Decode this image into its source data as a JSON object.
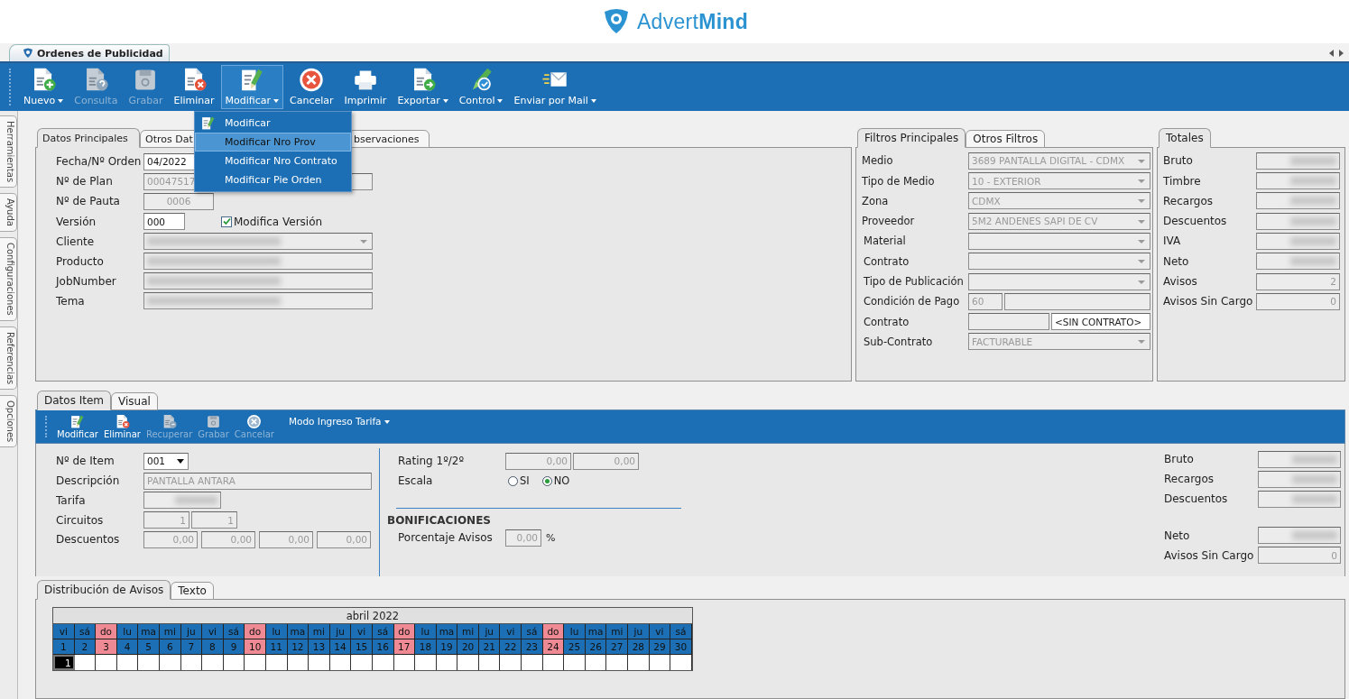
{
  "app": {
    "logo": "Advert**Mind**"
  },
  "document_tab": {
    "title": "Ordenes de Publicidad"
  },
  "toolbar": [
    {
      "label": "Nuevo",
      "kind": "new",
      "disabled": false,
      "dropdown": true,
      "selected": false
    },
    {
      "label": "Consulta",
      "kind": "query",
      "disabled": true,
      "dropdown": false,
      "selected": false
    },
    {
      "label": "Grabar",
      "kind": "save",
      "disabled": true,
      "dropdown": false,
      "selected": false
    },
    {
      "label": "Eliminar",
      "kind": "delete",
      "disabled": false,
      "dropdown": false,
      "selected": false
    },
    {
      "label": "Modificar",
      "kind": "edit",
      "disabled": false,
      "dropdown": true,
      "selected": true
    },
    {
      "label": "Cancelar",
      "kind": "cancel",
      "disabled": false,
      "dropdown": false,
      "selected": false
    },
    {
      "label": "Imprimir",
      "kind": "print",
      "disabled": false,
      "dropdown": false,
      "selected": false
    },
    {
      "label": "Exportar",
      "kind": "export",
      "disabled": false,
      "dropdown": true,
      "selected": false
    },
    {
      "label": "Control",
      "kind": "control",
      "disabled": false,
      "dropdown": true,
      "selected": false
    },
    {
      "label": "Enviar por Mail",
      "kind": "mail",
      "disabled": false,
      "dropdown": true,
      "selected": false
    }
  ],
  "menu": [
    {
      "label": "Modificar",
      "kind": "edit",
      "selected": false
    },
    {
      "label": "Modificar Nro Prov",
      "kind": "plain",
      "selected": true
    },
    {
      "label": "Modificar Nro Contrato",
      "kind": "plain",
      "selected": false
    },
    {
      "label": "Modificar Pie Orden",
      "kind": "plain",
      "selected": false
    }
  ],
  "side_tabs": [
    "Herramientas",
    "Ayuda",
    "Configuraciones",
    "Referencias",
    "Opciones"
  ],
  "main_tabs": [
    {
      "label": "Datos Principales",
      "selected": true
    },
    {
      "label": "Otros Dat",
      "selected": false
    },
    {
      "label": "bservaciones",
      "selected": false
    }
  ],
  "datos_principales": {
    "fecha_orden": {
      "label": "Fecha/Nº Orden",
      "value": "04/2022",
      "editable": true
    },
    "plan": {
      "label": "Nº de Plan",
      "value": "00047517",
      "editable": false
    },
    "pauta": {
      "label": "Nº de Pauta",
      "value": "0006",
      "editable": false
    },
    "version": {
      "label": "Versión",
      "value": "000",
      "editable": true
    },
    "modifica_version": {
      "label": "Modifica Versión",
      "checked": true
    },
    "cliente": {
      "label": "Cliente",
      "redacted": true
    },
    "producto": {
      "label": "Producto",
      "redacted": true
    },
    "jobnumber": {
      "label": "JobNumber",
      "redacted": true
    },
    "tema": {
      "label": "Tema",
      "redacted": true
    }
  },
  "filtros": {
    "tabs": [
      {
        "label": "Filtros Principales",
        "selected": true
      },
      {
        "label": "Otros Filtros",
        "selected": false
      }
    ],
    "rows": [
      {
        "label": "Medio",
        "kind": "select",
        "value": "3689 PANTALLA DIGITAL - CDMX"
      },
      {
        "label": "Tipo de Medio",
        "kind": "select",
        "value": "10 - EXTERIOR"
      },
      {
        "label": "Zona",
        "kind": "select",
        "value": "CDMX"
      },
      {
        "label": "Proveedor",
        "kind": "select",
        "value": "5M2 ANDENES SAPI DE CV"
      },
      {
        "label": "Material",
        "kind": "select"
      },
      {
        "label": "Contrato",
        "kind": "select"
      },
      {
        "label": "Tipo de Publicación",
        "kind": "select"
      },
      {
        "label": "Condición de Pago",
        "kind": "pair",
        "value": "60"
      },
      {
        "label": "Contrato",
        "kind": "pair-wide",
        "value_2": "<SIN CONTRATO>"
      },
      {
        "label": "Sub-Contrato",
        "kind": "select",
        "value": "FACTURABLE"
      }
    ]
  },
  "totales": {
    "tab": "Totales",
    "rows": [
      {
        "label": "Bruto",
        "redacted": true
      },
      {
        "label": "Timbre",
        "redacted": true
      },
      {
        "label": "Recargos",
        "redacted": true
      },
      {
        "label": "Descuentos",
        "redacted": true
      },
      {
        "label": "IVA",
        "redacted": true
      },
      {
        "label": "Neto",
        "redacted": true
      },
      {
        "label": "Avisos",
        "value": "2"
      },
      {
        "label": "Avisos Sin Cargo",
        "value": "0"
      }
    ]
  },
  "item_tabs": [
    {
      "label": "Datos Item",
      "selected": true
    },
    {
      "label": "Visual",
      "selected": false
    }
  ],
  "item_toolbar": {
    "buttons": [
      {
        "label": "Modificar",
        "kind": "edit",
        "disabled": false
      },
      {
        "label": "Eliminar",
        "kind": "delete",
        "disabled": false
      },
      {
        "label": "Recuperar",
        "kind": "recover",
        "disabled": true
      },
      {
        "label": "Grabar",
        "kind": "save",
        "disabled": true
      },
      {
        "label": "Cancelar",
        "kind": "cancel",
        "disabled": true
      }
    ],
    "mode_menu": "Modo Ingreso Tarifa"
  },
  "item_form": {
    "item_no": {
      "label": "Nº de Item",
      "value": "001"
    },
    "descripcion": {
      "label": "Descripción",
      "value": "PANTALLA ANTARA"
    },
    "tarifa": {
      "label": "Tarifa",
      "redacted": true
    },
    "circuitos": {
      "label": "Circuitos",
      "values": [
        "1",
        "1"
      ]
    },
    "descuentos": {
      "label": "Descuentos",
      "values": [
        "0,00",
        "0,00",
        "0,00",
        "0,00"
      ]
    },
    "rating": {
      "label": "Rating 1º/2º",
      "values": [
        "0,00",
        "0,00"
      ]
    },
    "escala": {
      "label": "Escala",
      "options": [
        {
          "label": "SI",
          "selected": false
        },
        {
          "label": "NO",
          "selected": true
        }
      ]
    },
    "bonificaciones": {
      "title": "BONIFICACIONES",
      "label": "Porcentaje Avisos",
      "value": "0,00",
      "unit": "%"
    }
  },
  "item_totals": {
    "groups": [
      {
        "rows": [
          {
            "label": "Bruto",
            "redacted": true
          },
          {
            "label": "Recargos",
            "redacted": true
          },
          {
            "label": "Descuentos",
            "redacted": true
          }
        ]
      },
      {
        "rows": [
          {
            "label": "Neto",
            "redacted": true
          },
          {
            "label": "Avisos Sin Cargo",
            "value": "0"
          }
        ]
      }
    ]
  },
  "distribution": {
    "tabs": [
      {
        "label": "Distribución de Avisos",
        "selected": true
      },
      {
        "label": "Texto",
        "selected": false
      }
    ],
    "calendar": {
      "month": "abril 2022",
      "days": [
        {
          "weekday": "vi",
          "day": "1",
          "color": "#1c6fb4",
          "count": "1",
          "selected": true
        },
        {
          "weekday": "sá",
          "day": "2",
          "color": "#1c6fb4",
          "selected": false
        },
        {
          "weekday": "do",
          "day": "3",
          "color": "#ef8a94",
          "selected": false
        },
        {
          "weekday": "lu",
          "day": "4",
          "color": "#1c6fb4",
          "selected": false
        },
        {
          "weekday": "ma",
          "day": "5",
          "color": "#1c6fb4",
          "selected": false
        },
        {
          "weekday": "mi",
          "day": "6",
          "color": "#1c6fb4",
          "selected": false
        },
        {
          "weekday": "ju",
          "day": "7",
          "color": "#1c6fb4",
          "selected": false
        },
        {
          "weekday": "vi",
          "day": "8",
          "color": "#1c6fb4",
          "selected": false
        },
        {
          "weekday": "sá",
          "day": "9",
          "color": "#1c6fb4",
          "selected": false
        },
        {
          "weekday": "do",
          "day": "10",
          "color": "#ef8a94",
          "selected": false
        },
        {
          "weekday": "lu",
          "day": "11",
          "color": "#1c6fb4",
          "selected": false
        },
        {
          "weekday": "ma",
          "day": "12",
          "color": "#1c6fb4",
          "selected": false
        },
        {
          "weekday": "mi",
          "day": "13",
          "color": "#1c6fb4",
          "selected": false
        },
        {
          "weekday": "ju",
          "day": "14",
          "color": "#1c6fb4",
          "selected": false
        },
        {
          "weekday": "vi",
          "day": "15",
          "color": "#1c6fb4",
          "selected": false
        },
        {
          "weekday": "sá",
          "day": "16",
          "color": "#1c6fb4",
          "selected": false
        },
        {
          "weekday": "do",
          "day": "17",
          "color": "#ef8a94",
          "selected": false
        },
        {
          "weekday": "lu",
          "day": "18",
          "color": "#1c6fb4",
          "selected": false
        },
        {
          "weekday": "ma",
          "day": "19",
          "color": "#1c6fb4",
          "selected": false
        },
        {
          "weekday": "mi",
          "day": "20",
          "color": "#1c6fb4",
          "selected": false
        },
        {
          "weekday": "ju",
          "day": "21",
          "color": "#1c6fb4",
          "selected": false
        },
        {
          "weekday": "vi",
          "day": "22",
          "color": "#1c6fb4",
          "selected": false
        },
        {
          "weekday": "sá",
          "day": "23",
          "color": "#1c6fb4",
          "selected": false
        },
        {
          "weekday": "do",
          "day": "24",
          "color": "#ef8a94",
          "selected": false
        },
        {
          "weekday": "lu",
          "day": "25",
          "color": "#1c6fb4",
          "selected": false
        },
        {
          "weekday": "ma",
          "day": "26",
          "color": "#1c6fb4",
          "selected": false
        },
        {
          "weekday": "mi",
          "day": "27",
          "color": "#1c6fb4",
          "selected": false
        },
        {
          "weekday": "ju",
          "day": "28",
          "color": "#1c6fb4",
          "selected": false
        },
        {
          "weekday": "vi",
          "day": "29",
          "color": "#1c6fb4",
          "selected": false
        },
        {
          "weekday": "sá",
          "day": "30",
          "color": "#1c6fb4",
          "selected": false
        }
      ]
    }
  }
}
